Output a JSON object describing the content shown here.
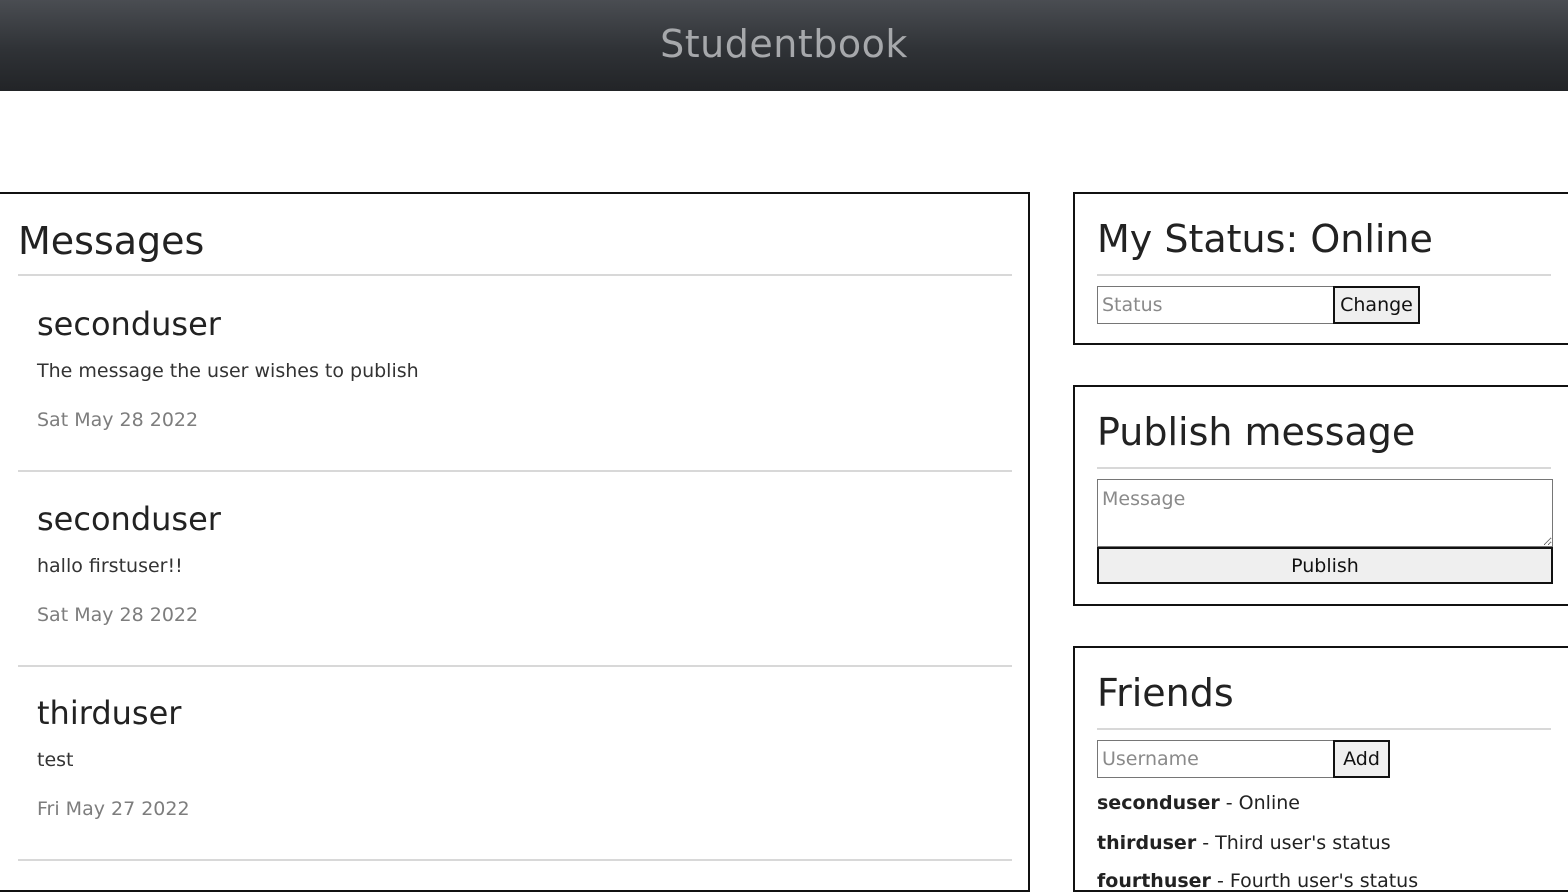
{
  "app": {
    "title": "Studentbook"
  },
  "messages": {
    "heading": "Messages",
    "items": [
      {
        "user": "seconduser",
        "text": "The message the user wishes to publish",
        "date": "Sat May 28 2022"
      },
      {
        "user": "seconduser",
        "text": "hallo firstuser!!",
        "date": "Sat May 28 2022"
      },
      {
        "user": "thirduser",
        "text": "test",
        "date": "Fri May 27 2022"
      }
    ]
  },
  "status": {
    "heading": "My Status: Online",
    "input_placeholder": "Status",
    "button_label": "Change"
  },
  "publish": {
    "heading": "Publish message",
    "textarea_placeholder": "Message",
    "button_label": "Publish"
  },
  "friends": {
    "heading": "Friends",
    "input_placeholder": "Username",
    "button_label": "Add",
    "separator": " - ",
    "items": [
      {
        "name": "seconduser",
        "status": "Online"
      },
      {
        "name": "thirduser",
        "status": "Third user's status"
      },
      {
        "name": "fourthuser",
        "status": "Fourth user's status"
      }
    ]
  }
}
